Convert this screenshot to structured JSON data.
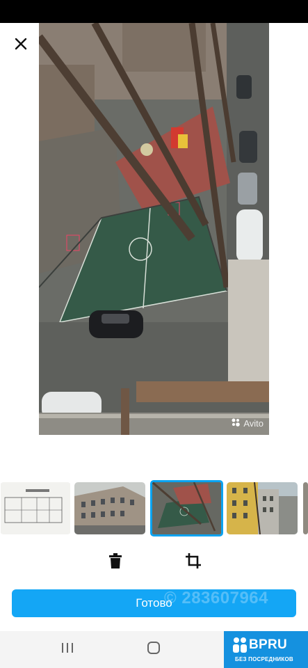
{
  "viewer": {
    "image_description_icon": "photo",
    "watermark": "Avito"
  },
  "thumbnails": [
    {
      "name": "floor-plan",
      "selected": false
    },
    {
      "name": "building-facade",
      "selected": false
    },
    {
      "name": "sports-court",
      "selected": true
    },
    {
      "name": "yellow-building",
      "selected": false
    },
    {
      "name": "partial-thumb",
      "selected": false
    }
  ],
  "actions": {
    "done_label": "Готово"
  },
  "overlay": {
    "phone_watermark": "© 283607964"
  },
  "brand": {
    "name": "BPRU",
    "tagline": "БЕЗ ПОСРЕДНИКОВ"
  },
  "colors": {
    "accent": "#14a6f5",
    "brand": "#1591df"
  }
}
